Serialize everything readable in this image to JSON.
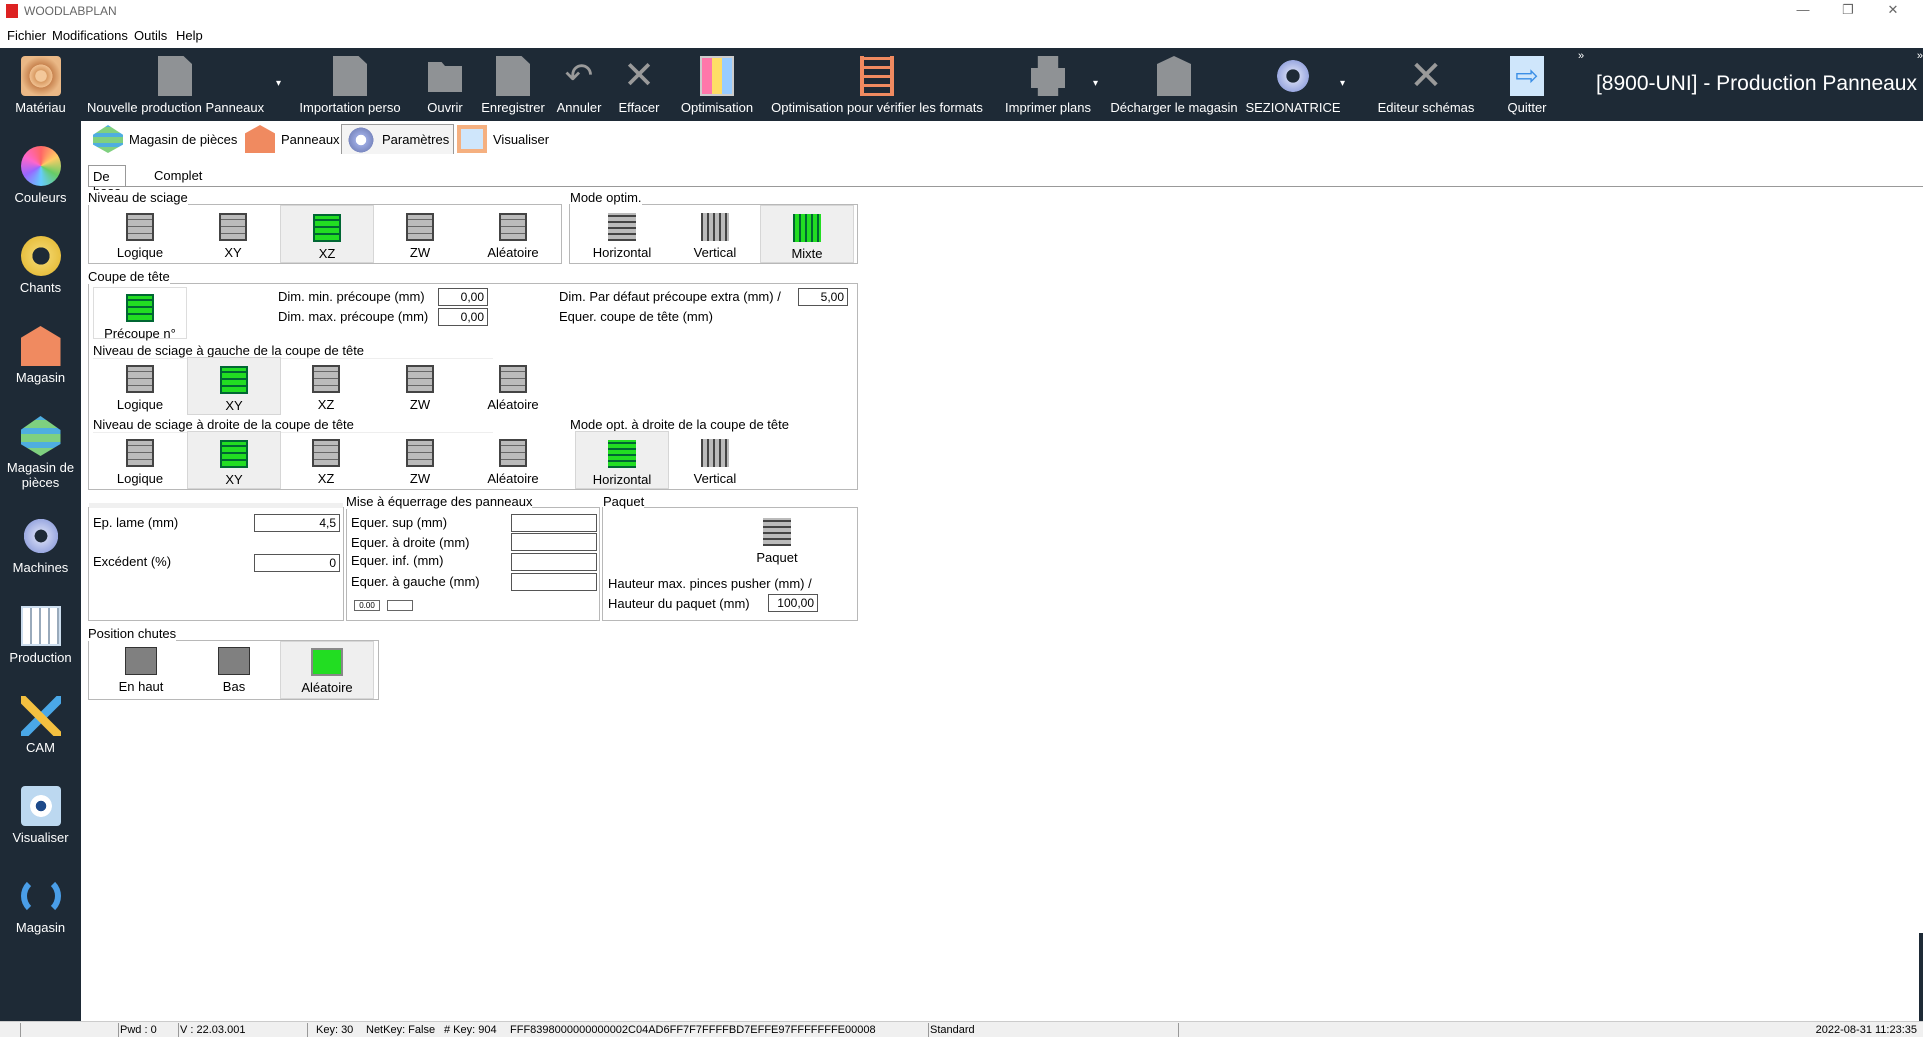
{
  "window": {
    "title": "WOODLABPLAN",
    "controls": [
      "—",
      "❐",
      "✕"
    ]
  },
  "menu": [
    "Fichier",
    "Modifications",
    "Outils",
    "Help"
  ],
  "sidebar": {
    "items": [
      {
        "label": "Matériau",
        "icon": "wood-icon"
      },
      {
        "label": "Couleurs",
        "icon": "color-wheel-icon"
      },
      {
        "label": "Chants",
        "icon": "edge-tape-icon"
      },
      {
        "label": "Magasin",
        "icon": "warehouse-icon"
      },
      {
        "label": "Magasin de pièces",
        "icon": "stack-icon"
      },
      {
        "label": "Machines",
        "icon": "gear-icon"
      },
      {
        "label": "Production",
        "icon": "panels-icon"
      },
      {
        "label": "CAM",
        "icon": "pencil-ruler-icon"
      },
      {
        "label": "Visualiser",
        "icon": "eye-icon"
      },
      {
        "label": "Magasin",
        "icon": "refresh-icon"
      }
    ]
  },
  "toolbar": {
    "buttons": [
      {
        "label": "Nouvelle production Panneaux",
        "icon": "new-doc-icon"
      },
      {
        "label": "Importation perso",
        "icon": "import-doc-icon"
      },
      {
        "label": "Ouvrir",
        "icon": "folder-icon"
      },
      {
        "label": "Enregistrer",
        "icon": "save-icon"
      },
      {
        "label": "Annuler",
        "icon": "undo-icon"
      },
      {
        "label": "Effacer",
        "icon": "delete-icon"
      },
      {
        "label": "Optimisation",
        "icon": "optimization-icon"
      },
      {
        "label": "Optimisation pour vérifier les formats",
        "icon": "ladder-icon"
      },
      {
        "label": "Imprimer plans",
        "icon": "printer-icon"
      },
      {
        "label": "Décharger le magasin",
        "icon": "unload-icon"
      },
      {
        "label": "SEZIONATRICE",
        "icon": "machine-gear-icon"
      },
      {
        "label": "Editeur schémas",
        "icon": "editor-x-icon"
      },
      {
        "label": "Quitter",
        "icon": "exit-icon"
      }
    ],
    "project_title": "[8900-UNI] - Production Panneaux",
    "overflow": "»"
  },
  "tabs": [
    {
      "label": "Magasin de pièces"
    },
    {
      "label": "Panneaux"
    },
    {
      "label": "Paramètres"
    },
    {
      "label": "Visualiser"
    }
  ],
  "subtabs": [
    "De base",
    "Complet"
  ],
  "niveau_sciage": {
    "title": "Niveau de sciage",
    "options": [
      "Logique",
      "XY",
      "XZ",
      "ZW",
      "Aléatoire"
    ],
    "selected": "XZ"
  },
  "mode_optim": {
    "title": "Mode optim.",
    "options": [
      "Horizontal",
      "Vertical",
      "Mixte"
    ],
    "selected": "Mixte"
  },
  "coupe_tete": {
    "title": "Coupe de tête",
    "precoupe_label": "Précoupe n°",
    "dim_min_label": "Dim. min. précoupe (mm)",
    "dim_min_value": "0,00",
    "dim_max_label": "Dim. max. précoupe (mm)",
    "dim_max_value": "0,00",
    "dim_defaut_label": "Dim. Par défaut précoupe extra (mm) /",
    "dim_defaut_value": "5,00",
    "equer_label": "Equer. coupe de tête (mm)",
    "gauche_title": "Niveau de sciage à gauche de la coupe de tête",
    "gauche_options": [
      "Logique",
      "XY",
      "XZ",
      "ZW",
      "Aléatoire"
    ],
    "gauche_selected": "XY",
    "droite_title": "Niveau de sciage à droite de la coupe de tête",
    "droite_options": [
      "Logique",
      "XY",
      "XZ",
      "ZW",
      "Aléatoire"
    ],
    "droite_selected": "XY",
    "mode_droite_title": "Mode opt.  à droite de la coupe de tête",
    "mode_droite_options": [
      "Horizontal",
      "Vertical"
    ],
    "mode_droite_selected": "Horizontal"
  },
  "lame": {
    "ep_label": "Ep. lame (mm)",
    "ep_value": "4,5",
    "excedent_label": "Excédent (%)",
    "excedent_value": "0"
  },
  "equerrage": {
    "title": "Mise à équerrage des panneaux",
    "sup_label": "Equer. sup (mm)",
    "droite_label": "Equer. à droite (mm)",
    "inf_label": "Equer. inf. (mm)",
    "gauche_label": "Equer. à gauche (mm)",
    "small_value": "0.00"
  },
  "paquet": {
    "title": "Paquet",
    "icon_label": "Paquet",
    "hauteur_max_label": "Hauteur max. pinces pusher (mm) /",
    "hauteur_paquet_label": "Hauteur du paquet (mm)",
    "hauteur_paquet_value": "100,00"
  },
  "position_chutes": {
    "title": "Position chutes",
    "options": [
      "En haut",
      "Bas",
      "Aléatoire"
    ],
    "selected": "Aléatoire"
  },
  "statusbar": {
    "pwd": "Pwd : 0",
    "version": "V : 22.03.001",
    "key": "Key: 30",
    "netkey": "NetKey: False",
    "nkey": "# Key: 904",
    "hash": "FFF8398000000000002C04AD6FF7F7FFFFBD7EFFE97FFFFFFFE00008",
    "mode": "Standard",
    "datetime": "2022-08-31 11:23:35"
  }
}
